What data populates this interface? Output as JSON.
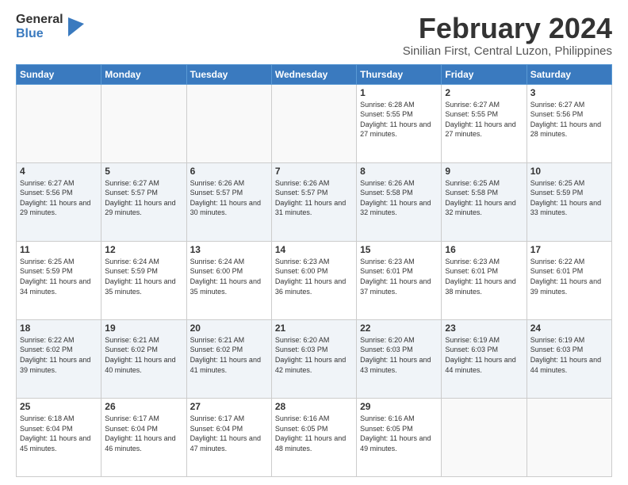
{
  "logo": {
    "general": "General",
    "blue": "Blue"
  },
  "title": {
    "month_year": "February 2024",
    "location": "Sinilian First, Central Luzon, Philippines"
  },
  "days_of_week": [
    "Sunday",
    "Monday",
    "Tuesday",
    "Wednesday",
    "Thursday",
    "Friday",
    "Saturday"
  ],
  "weeks": [
    [
      {
        "day": "",
        "info": ""
      },
      {
        "day": "",
        "info": ""
      },
      {
        "day": "",
        "info": ""
      },
      {
        "day": "",
        "info": ""
      },
      {
        "day": "1",
        "info": "Sunrise: 6:28 AM\nSunset: 5:55 PM\nDaylight: 11 hours and 27 minutes."
      },
      {
        "day": "2",
        "info": "Sunrise: 6:27 AM\nSunset: 5:55 PM\nDaylight: 11 hours and 27 minutes."
      },
      {
        "day": "3",
        "info": "Sunrise: 6:27 AM\nSunset: 5:56 PM\nDaylight: 11 hours and 28 minutes."
      }
    ],
    [
      {
        "day": "4",
        "info": "Sunrise: 6:27 AM\nSunset: 5:56 PM\nDaylight: 11 hours and 29 minutes."
      },
      {
        "day": "5",
        "info": "Sunrise: 6:27 AM\nSunset: 5:57 PM\nDaylight: 11 hours and 29 minutes."
      },
      {
        "day": "6",
        "info": "Sunrise: 6:26 AM\nSunset: 5:57 PM\nDaylight: 11 hours and 30 minutes."
      },
      {
        "day": "7",
        "info": "Sunrise: 6:26 AM\nSunset: 5:57 PM\nDaylight: 11 hours and 31 minutes."
      },
      {
        "day": "8",
        "info": "Sunrise: 6:26 AM\nSunset: 5:58 PM\nDaylight: 11 hours and 32 minutes."
      },
      {
        "day": "9",
        "info": "Sunrise: 6:25 AM\nSunset: 5:58 PM\nDaylight: 11 hours and 32 minutes."
      },
      {
        "day": "10",
        "info": "Sunrise: 6:25 AM\nSunset: 5:59 PM\nDaylight: 11 hours and 33 minutes."
      }
    ],
    [
      {
        "day": "11",
        "info": "Sunrise: 6:25 AM\nSunset: 5:59 PM\nDaylight: 11 hours and 34 minutes."
      },
      {
        "day": "12",
        "info": "Sunrise: 6:24 AM\nSunset: 5:59 PM\nDaylight: 11 hours and 35 minutes."
      },
      {
        "day": "13",
        "info": "Sunrise: 6:24 AM\nSunset: 6:00 PM\nDaylight: 11 hours and 35 minutes."
      },
      {
        "day": "14",
        "info": "Sunrise: 6:23 AM\nSunset: 6:00 PM\nDaylight: 11 hours and 36 minutes."
      },
      {
        "day": "15",
        "info": "Sunrise: 6:23 AM\nSunset: 6:01 PM\nDaylight: 11 hours and 37 minutes."
      },
      {
        "day": "16",
        "info": "Sunrise: 6:23 AM\nSunset: 6:01 PM\nDaylight: 11 hours and 38 minutes."
      },
      {
        "day": "17",
        "info": "Sunrise: 6:22 AM\nSunset: 6:01 PM\nDaylight: 11 hours and 39 minutes."
      }
    ],
    [
      {
        "day": "18",
        "info": "Sunrise: 6:22 AM\nSunset: 6:02 PM\nDaylight: 11 hours and 39 minutes."
      },
      {
        "day": "19",
        "info": "Sunrise: 6:21 AM\nSunset: 6:02 PM\nDaylight: 11 hours and 40 minutes."
      },
      {
        "day": "20",
        "info": "Sunrise: 6:21 AM\nSunset: 6:02 PM\nDaylight: 11 hours and 41 minutes."
      },
      {
        "day": "21",
        "info": "Sunrise: 6:20 AM\nSunset: 6:03 PM\nDaylight: 11 hours and 42 minutes."
      },
      {
        "day": "22",
        "info": "Sunrise: 6:20 AM\nSunset: 6:03 PM\nDaylight: 11 hours and 43 minutes."
      },
      {
        "day": "23",
        "info": "Sunrise: 6:19 AM\nSunset: 6:03 PM\nDaylight: 11 hours and 44 minutes."
      },
      {
        "day": "24",
        "info": "Sunrise: 6:19 AM\nSunset: 6:03 PM\nDaylight: 11 hours and 44 minutes."
      }
    ],
    [
      {
        "day": "25",
        "info": "Sunrise: 6:18 AM\nSunset: 6:04 PM\nDaylight: 11 hours and 45 minutes."
      },
      {
        "day": "26",
        "info": "Sunrise: 6:17 AM\nSunset: 6:04 PM\nDaylight: 11 hours and 46 minutes."
      },
      {
        "day": "27",
        "info": "Sunrise: 6:17 AM\nSunset: 6:04 PM\nDaylight: 11 hours and 47 minutes."
      },
      {
        "day": "28",
        "info": "Sunrise: 6:16 AM\nSunset: 6:05 PM\nDaylight: 11 hours and 48 minutes."
      },
      {
        "day": "29",
        "info": "Sunrise: 6:16 AM\nSunset: 6:05 PM\nDaylight: 11 hours and 49 minutes."
      },
      {
        "day": "",
        "info": ""
      },
      {
        "day": "",
        "info": ""
      }
    ]
  ]
}
